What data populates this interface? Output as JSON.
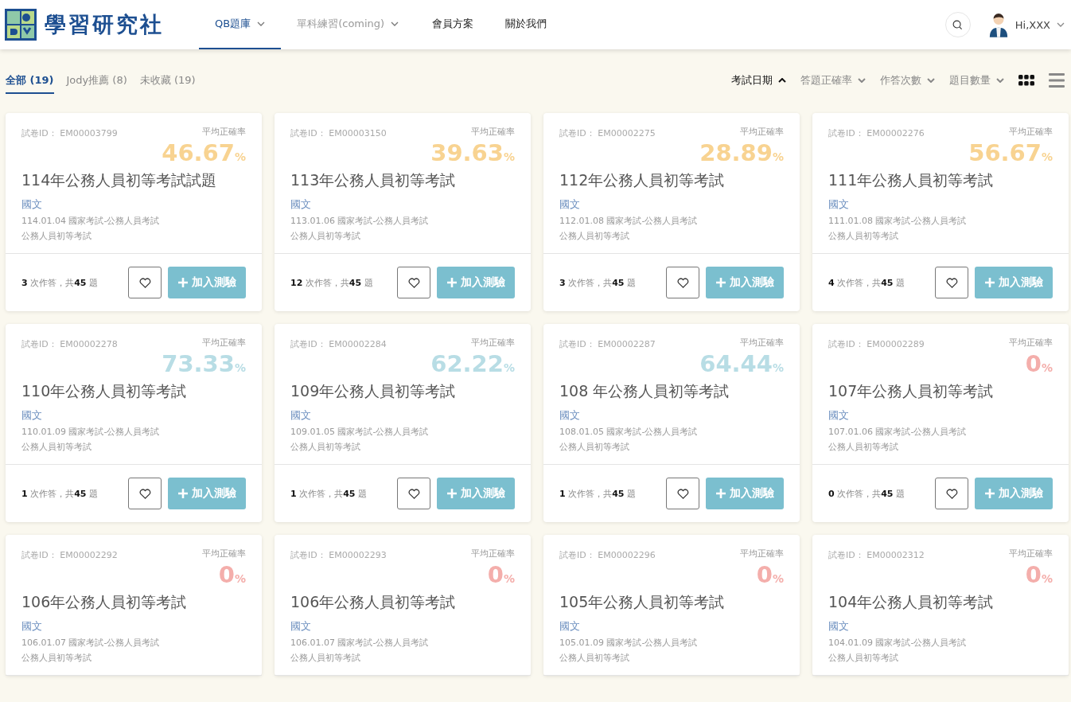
{
  "header": {
    "logo_text": "學習研究社",
    "nav": [
      {
        "label": "QB題庫",
        "dropdown": true,
        "selected": true,
        "disabled": false
      },
      {
        "label": "單科練習(coming)",
        "dropdown": true,
        "selected": false,
        "disabled": true
      },
      {
        "label": "會員方案",
        "dropdown": false,
        "selected": false,
        "disabled": false
      },
      {
        "label": "關於我們",
        "dropdown": false,
        "selected": false,
        "disabled": false
      }
    ],
    "user": {
      "greeting": "Hi,XXX"
    }
  },
  "filters": [
    {
      "label": "全部 (19)",
      "selected": true
    },
    {
      "label": "Jody推薦 (8)",
      "selected": false
    },
    {
      "label": "未收藏 (19)",
      "selected": false
    }
  ],
  "sort": [
    {
      "label": "考試日期",
      "selected": true
    },
    {
      "label": "答題正確率",
      "selected": false
    },
    {
      "label": "作答次數",
      "selected": false
    },
    {
      "label": "題目數量",
      "selected": false
    }
  ],
  "views": [
    {
      "kind": "grid",
      "selected": true
    },
    {
      "kind": "list",
      "selected": false
    }
  ],
  "cards": [
    {
      "id_label": "試卷ID： EM00003799",
      "rate_label": "平均正確率",
      "rate": "46.67",
      "unit": "%",
      "color": "#f8d391",
      "title": "114年公務人員初等考試試題",
      "subject": "國文",
      "info": "114.01.04 國家考試-公務人員考試",
      "category": "公務人員初等考試",
      "stats": "**3** 次作答，共**45** 題",
      "favorite": false,
      "add_label": "加入測驗"
    },
    {
      "id_label": "試卷ID： EM00003150",
      "rate_label": "平均正確率",
      "rate": "39.63",
      "unit": "%",
      "color": "#f8d391",
      "title": "113年公務人員初等考試",
      "subject": "國文",
      "info": "113.01.06 國家考試-公務人員考試",
      "category": "公務人員初等考試",
      "stats": "**12** 次作答，共**45** 題",
      "favorite": false,
      "add_label": "加入測驗"
    },
    {
      "id_label": "試卷ID： EM00002275",
      "rate_label": "平均正確率",
      "rate": "28.89",
      "unit": "%",
      "color": "#f8d391",
      "title": "112年公務人員初等考試",
      "subject": "國文",
      "info": "112.01.08 國家考試-公務人員考試",
      "category": "公務人員初等考試",
      "stats": "**3** 次作答，共**45** 題",
      "favorite": false,
      "add_label": "加入測驗"
    },
    {
      "id_label": "試卷ID： EM00002276",
      "rate_label": "平均正確率",
      "rate": "56.67",
      "unit": "%",
      "color": "#f8d391",
      "title": "111年公務人員初等考試",
      "subject": "國文",
      "info": "111.01.08 國家考試-公務人員考試",
      "category": "公務人員初等考試",
      "stats": "**4** 次作答，共**45** 題",
      "favorite": false,
      "add_label": "加入測驗"
    },
    {
      "id_label": "試卷ID： EM00002278",
      "rate_label": "平均正確率",
      "rate": "73.33",
      "unit": "%",
      "color": "#b8dde5",
      "title": "110年公務人員初等考試",
      "subject": "國文",
      "info": "110.01.09 國家考試-公務人員考試",
      "category": "公務人員初等考試",
      "stats": "**1** 次作答，共**45** 題",
      "favorite": false,
      "add_label": "加入測驗"
    },
    {
      "id_label": "試卷ID： EM00002284",
      "rate_label": "平均正確率",
      "rate": "62.22",
      "unit": "%",
      "color": "#b8dde5",
      "title": "109年公務人員初等考試",
      "subject": "國文",
      "info": "109.01.05 國家考試-公務人員考試",
      "category": "公務人員初等考試",
      "stats": "**1** 次作答，共**45** 題",
      "favorite": false,
      "add_label": "加入測驗"
    },
    {
      "id_label": "試卷ID： EM00002287",
      "rate_label": "平均正確率",
      "rate": "64.44",
      "unit": "%",
      "color": "#b8dde5",
      "title": "108 年公務人員初等考試",
      "subject": "國文",
      "info": "108.01.05 國家考試-公務人員考試",
      "category": "公務人員初等考試",
      "stats": "**1** 次作答，共**45** 題",
      "favorite": false,
      "add_label": "加入測驗"
    },
    {
      "id_label": "試卷ID： EM00002289",
      "rate_label": "平均正確率",
      "rate": "0",
      "unit": "%",
      "color": "#f4aeab",
      "title": "107年公務人員初等考試",
      "subject": "國文",
      "info": "107.01.06 國家考試-公務人員考試",
      "category": "公務人員初等考試",
      "stats": "**0** 次作答，共**45** 題",
      "favorite": false,
      "add_label": "加入測驗"
    },
    {
      "id_label": "試卷ID： EM00002292",
      "rate_label": "平均正確率",
      "rate": "0",
      "unit": "%",
      "color": "#f4aeab",
      "title": "106年公務人員初等考試",
      "subject": "國文",
      "info": "106.01.07 國家考試-公務人員考試",
      "category": "公務人員初等考試"
    },
    {
      "id_label": "試卷ID： EM00002293",
      "rate_label": "平均正確率",
      "rate": "0",
      "unit": "%",
      "color": "#f4aeab",
      "title": "106年公務人員初等考試",
      "subject": "國文",
      "info": "106.01.07 國家考試-公務人員考試",
      "category": "公務人員初等考試"
    },
    {
      "id_label": "試卷ID： EM00002296",
      "rate_label": "平均正確率",
      "rate": "0",
      "unit": "%",
      "color": "#f4aeab",
      "title": "105年公務人員初等考試",
      "subject": "國文",
      "info": "105.01.09 國家考試-公務人員考試",
      "category": "公務人員初等考試"
    },
    {
      "id_label": "試卷ID： EM00002312",
      "rate_label": "平均正確率",
      "rate": "0",
      "unit": "%",
      "color": "#f4aeab",
      "title": "104年公務人員初等考試",
      "subject": "國文",
      "info": "104.01.09 國家考試-公務人員考試",
      "category": "公務人員初等考試"
    }
  ]
}
